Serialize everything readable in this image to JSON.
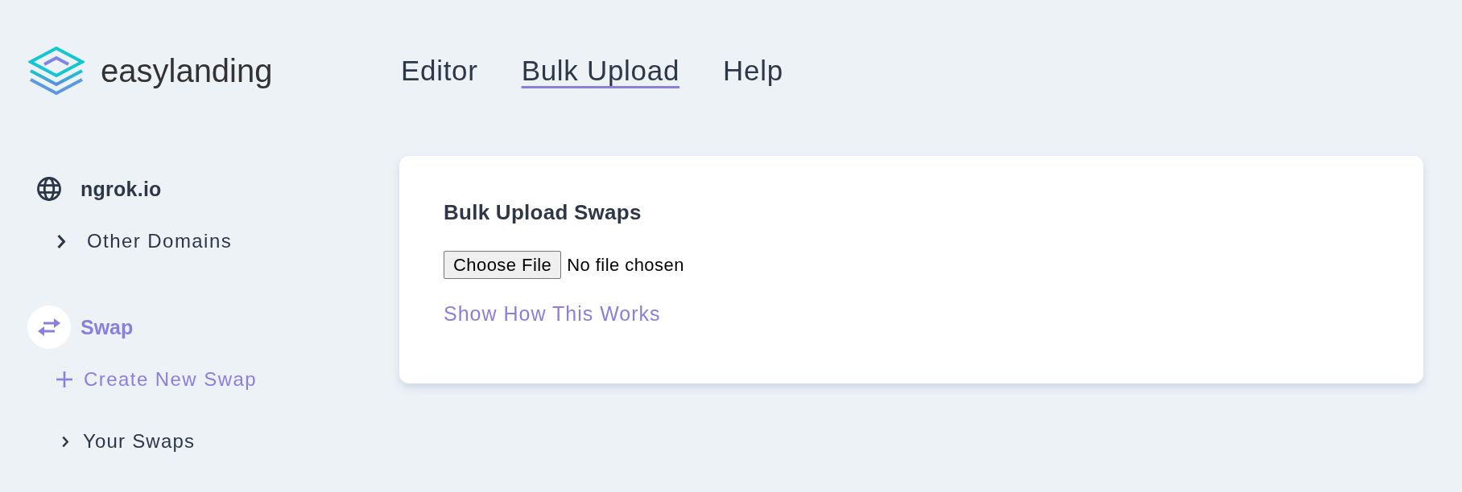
{
  "logo": {
    "name": "easylanding"
  },
  "nav": [
    {
      "label": "Editor",
      "selected": false
    },
    {
      "label": "Bulk Upload",
      "selected": true
    },
    {
      "label": "Help",
      "selected": false
    }
  ],
  "sidebar": {
    "domain": "ngrok.io",
    "other_domains": {
      "label": "Other Domains",
      "expanded": false
    },
    "section": {
      "label": "Swap",
      "selected": true
    },
    "section_items": [
      {
        "kind": "action",
        "label": "Create New Swap"
      },
      {
        "kind": "group",
        "label": "Your Swaps",
        "expanded": false
      }
    ]
  },
  "card": {
    "title": "Bulk Upload Swaps",
    "file_button": "Choose File",
    "file_status": "No file chosen",
    "link": "Show How This Works"
  }
}
